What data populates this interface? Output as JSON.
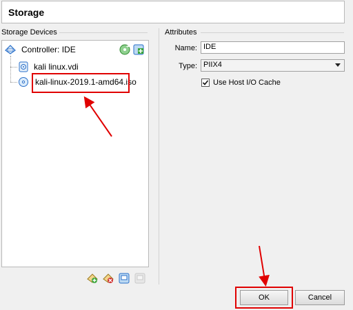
{
  "header": {
    "title": "Storage"
  },
  "storage_devices": {
    "label": "Storage Devices",
    "controller": {
      "label": "Controller: IDE",
      "icon": "ide-controller-icon"
    },
    "items": [
      {
        "label": "kali linux.vdi",
        "icon": "hard-disk-icon"
      },
      {
        "label": "kali-linux-2019.1-amd64.iso",
        "icon": "optical-disc-icon"
      }
    ],
    "controller_actions": [
      "add-optical-drive-icon",
      "add-hard-disk-icon"
    ],
    "bottom_actions": [
      "add-attachment-icon",
      "remove-attachment-icon",
      "add-controller-icon",
      "remove-controller-icon"
    ]
  },
  "attributes": {
    "label": "Attributes",
    "name_label": "Name:",
    "name_value": "IDE",
    "type_label": "Type:",
    "type_value": "PIIX4",
    "host_io_cache_label": "Use Host I/O Cache",
    "host_io_cache_checked": true
  },
  "buttons": {
    "ok": "OK",
    "cancel": "Cancel"
  },
  "colors": {
    "highlight": "#e00000",
    "accent_green": "#3aa53a",
    "accent_blue": "#2a6fc9"
  }
}
